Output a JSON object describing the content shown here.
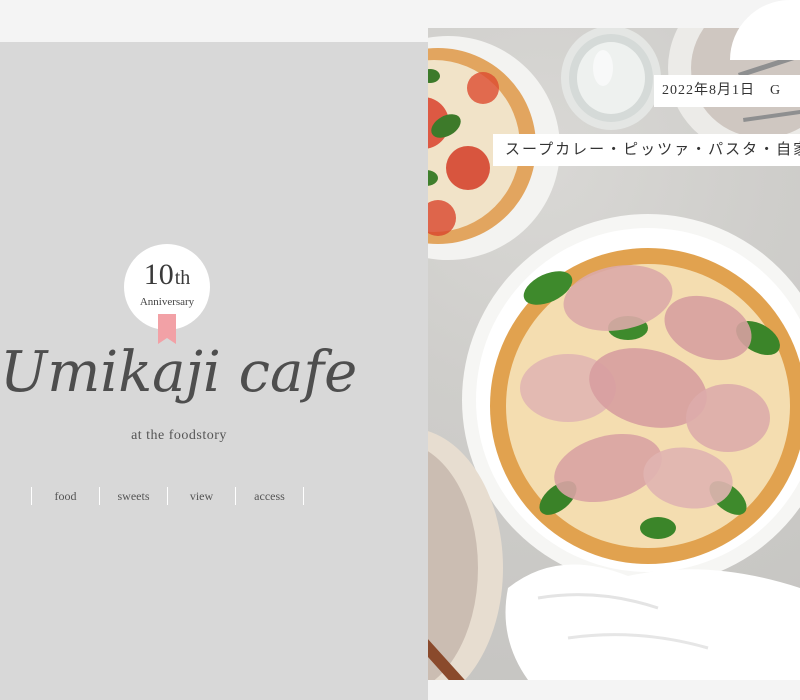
{
  "badge": {
    "number": "10",
    "suffix": "th",
    "label": "Anniversary"
  },
  "brand": {
    "title": "Umikaji cafe",
    "subtitle": "at the foodstory"
  },
  "nav": {
    "items": [
      "food",
      "sweets",
      "view",
      "access"
    ]
  },
  "hero": {
    "date_tag": "2022年8月1日　G",
    "menu_tag": "スープカレー・ピッツァ・パスタ・自家"
  },
  "colors": {
    "left_panel": "#d8d8d8",
    "ribbon": "#f2a1a6",
    "title_text": "#4e4e4e"
  }
}
